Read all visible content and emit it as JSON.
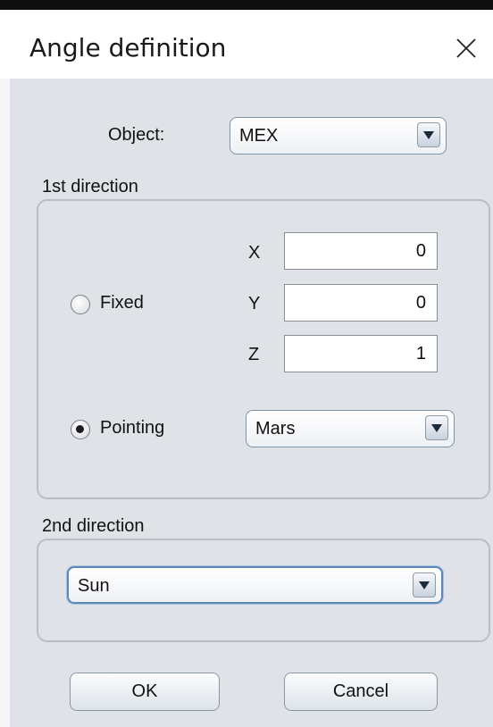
{
  "window": {
    "title": "Angle definition"
  },
  "object": {
    "label": "Object:",
    "value": "MEX"
  },
  "first_direction": {
    "label": "1st direction",
    "fixed": {
      "label": "Fixed",
      "selected": false,
      "x_label": "X",
      "x": "0",
      "y_label": "Y",
      "y": "0",
      "z_label": "Z",
      "z": "1"
    },
    "pointing": {
      "label": "Pointing",
      "selected": true,
      "value": "Mars"
    }
  },
  "second_direction": {
    "label": "2nd direction",
    "value": "Sun"
  },
  "buttons": {
    "ok": "OK",
    "cancel": "Cancel"
  },
  "icons": {
    "close": "close-icon",
    "dropdown": "chevron-down-icon"
  }
}
